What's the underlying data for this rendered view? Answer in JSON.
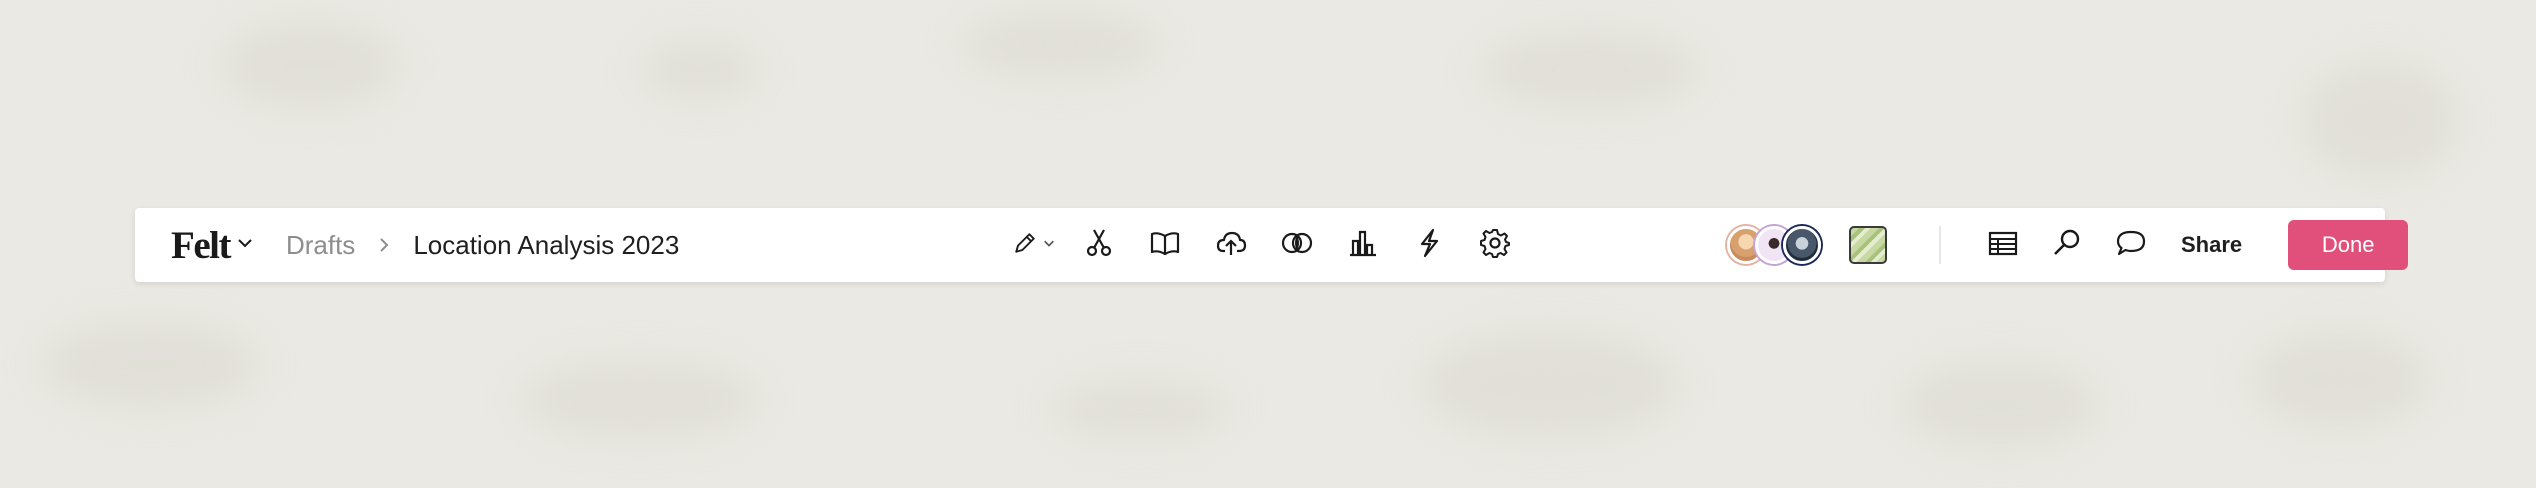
{
  "app": {
    "logo": "Felt"
  },
  "breadcrumb": {
    "folder": "Drafts",
    "title": "Location Analysis 2023"
  },
  "toolbar": {
    "tools": [
      {
        "name": "pencil-icon",
        "dropdown": true
      },
      {
        "name": "scissors-icon"
      },
      {
        "name": "book-icon"
      },
      {
        "name": "upload-icon"
      },
      {
        "name": "overlap-circles-icon"
      },
      {
        "name": "bar-chart-icon"
      },
      {
        "name": "lightning-icon"
      },
      {
        "name": "gear-icon"
      }
    ]
  },
  "collaborators": [
    "avatar-1",
    "avatar-2",
    "avatar-3"
  ],
  "right": {
    "share_label": "Share",
    "done_label": "Done",
    "done_color": "#e0507a"
  }
}
